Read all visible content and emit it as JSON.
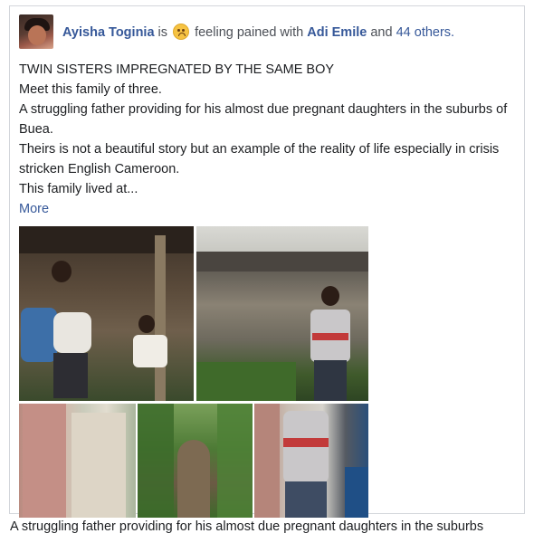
{
  "post": {
    "author": "Ayisha Toginia",
    "is_text": "is",
    "feeling_icon": "pained-face-emoji",
    "feeling_text": "feeling pained with",
    "tagged_name": "Adi Emile",
    "and_text": "and",
    "others_text": "44 others.",
    "paragraphs": [
      "TWIN SISTERS IMPREGNATED BY THE SAME BOY",
      "Meet this family of three.",
      "A struggling father providing for his almost due pregnant daughters in the suburbs of Buea.",
      "Theirs is not a beautiful story but an example of the reality of life especially in crisis stricken English Cameroon.",
      "This family lived at..."
    ],
    "more_label": "More"
  },
  "caption": "A struggling father providing for his almost due pregnant daughters in the suburbs",
  "colors": {
    "link": "#365899",
    "text": "#1c1e21",
    "border": "#d3d6db"
  }
}
